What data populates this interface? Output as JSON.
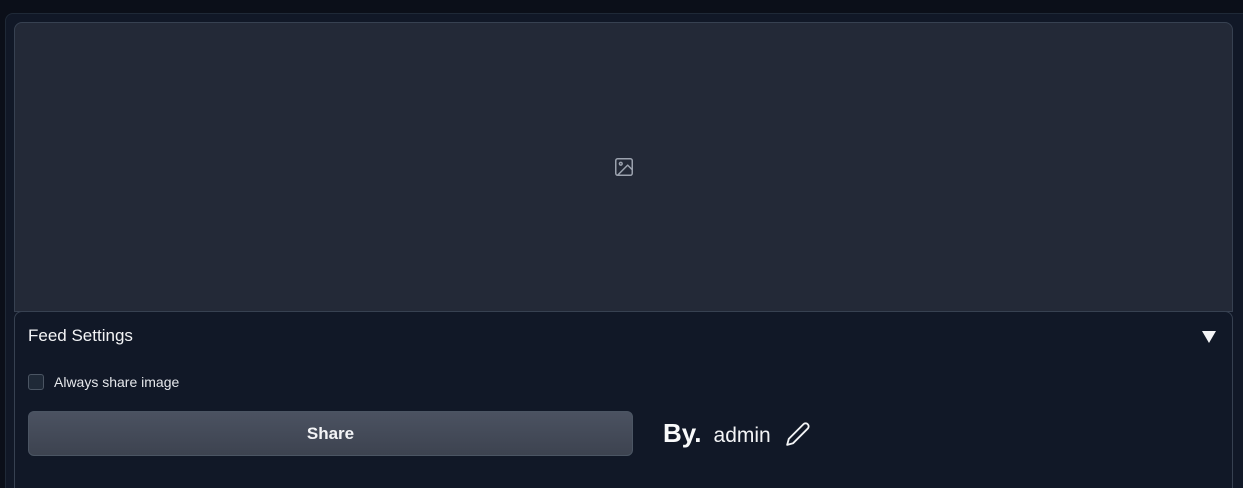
{
  "feed_settings": {
    "title": "Feed Settings",
    "collapse_icon": "caret-down-icon",
    "always_share_label": "Always share image",
    "always_share_checked": false
  },
  "image_panel": {
    "icon": "image-icon"
  },
  "share": {
    "button_label": "Share"
  },
  "author": {
    "by_label": "By.",
    "name": "admin",
    "edit_icon": "pencil-icon"
  }
}
